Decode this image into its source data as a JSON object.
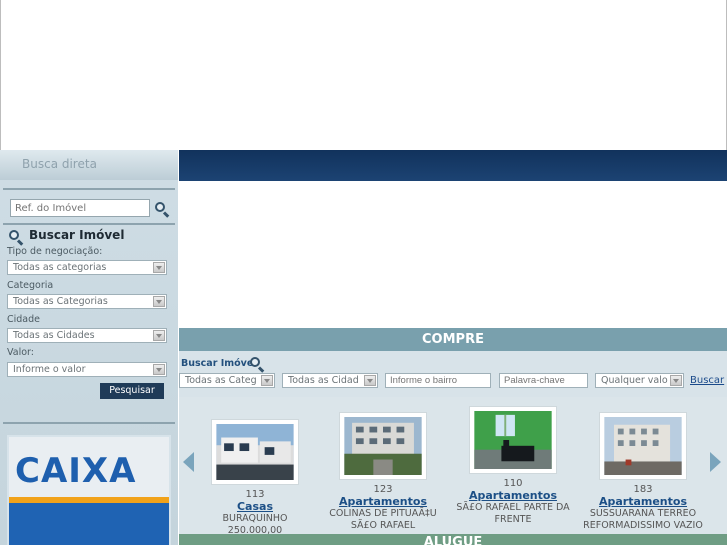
{
  "sidebar": {
    "title": "Busca direta",
    "ref_placeholder": "Ref. do Imóvel",
    "buscar_title": "Buscar Imóvel",
    "fields": [
      {
        "label": "Tipo de negociação:",
        "value": "Todas as categorias"
      },
      {
        "label": "Categoria",
        "value": "Todas as Categorias"
      },
      {
        "label": "Cidade",
        "value": "Todas as Cidades"
      },
      {
        "label": "Valor:",
        "value": "Informe o valor"
      }
    ],
    "search_button": "Pesquisar",
    "banner_logo": "CAIXA"
  },
  "main": {
    "compre_title": "COMPRE",
    "search_bar": {
      "label": "Buscar Imóvel",
      "category": "Todas as Categ",
      "city": "Todas as Cidad",
      "neighborhood_placeholder": "Informe o bairro",
      "keyword_placeholder": "Palavra-chave",
      "value": "Qualquer valo",
      "submit": "Buscar"
    },
    "listings": [
      {
        "count": "113",
        "type": "Casas",
        "desc1": "BURAQUINHO",
        "desc2": "250.000,00"
      },
      {
        "count": "123",
        "type": "Apartamentos",
        "desc1": "COLINAS DE PITUAÃ‡U",
        "desc2": "SÃ£O RAFAEL"
      },
      {
        "count": "110",
        "type": "Apartamentos",
        "desc1": "SÃ£O RAFAEL PARTE DA",
        "desc2": "FRENTE"
      },
      {
        "count": "183",
        "type": "Apartamentos",
        "desc1": "SUSSUARANA TERREO",
        "desc2": "REFORMADISSIMO VAZIO"
      }
    ],
    "aluguel_title": "ALUGUE"
  },
  "colors": {
    "header_blue": "#11325c",
    "compre_band": "#79a0ad",
    "aluguel_band": "#6f9d84",
    "button": "#1f3b58"
  }
}
